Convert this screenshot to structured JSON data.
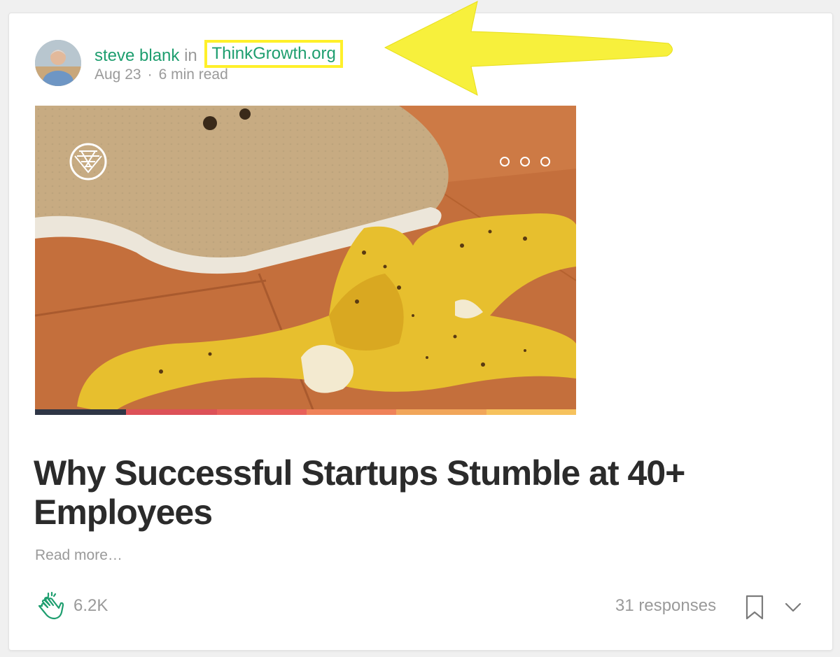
{
  "post": {
    "author": "steve blank",
    "in_word": "in",
    "publication": "ThinkGrowth.org",
    "date": "Aug 23",
    "separator": "·",
    "read_time": "6 min read",
    "title": "Why Successful Startups Stumble at 40+ Employees",
    "read_more": "Read more…"
  },
  "footer": {
    "claps": "6.2K",
    "responses": "31 responses"
  },
  "icons": {
    "clap": "clap-icon",
    "bookmark": "bookmark-icon",
    "chevron": "chevron-down-icon",
    "hero_logo": "diamond-grid-logo",
    "hero_dots": "carousel-dots-icon"
  },
  "colors": {
    "accent_green": "#1e9e6f",
    "highlight_yellow": "#fff02a",
    "arrow_yellow": "#f7f03c",
    "muted_text": "#9a9a9a",
    "title_text": "#2b2b2b"
  }
}
